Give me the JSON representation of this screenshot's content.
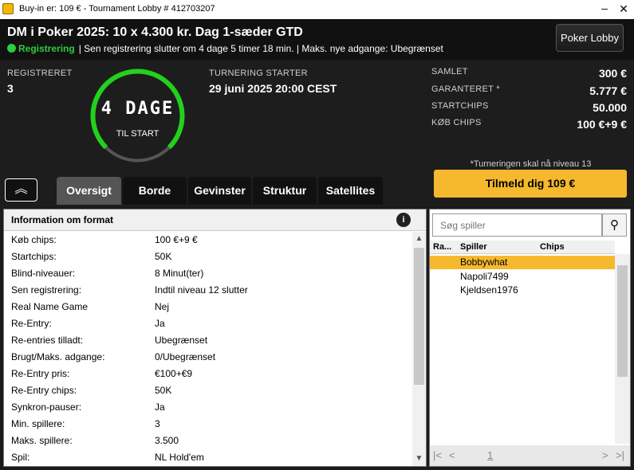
{
  "window": {
    "title": "Buy-in er: 109 € - Tournament Lobby # 412703207",
    "minimize": "–",
    "close": "✕"
  },
  "header": {
    "title": "DM i Poker 2025: 10 x 4.300 kr. Dag 1-sæder GTD",
    "status": "Registrering",
    "status_color": "#2ecc40",
    "info": "| Sen registrering slutter om 4 dage 5 timer   18 min.  | Maks. nye adgange: Ubegrænset",
    "lobby_button": "Poker Lobby"
  },
  "stats": {
    "registered_label": "REGISTRERET",
    "registered_value": "3",
    "countdown_value": "4 DAGE",
    "countdown_label": "TIL START",
    "start_label": "TURNERING STARTER",
    "start_value": "29 juni 2025  20:00 CEST"
  },
  "summary": {
    "rows": [
      {
        "label": "SAMLET",
        "value": "300 €"
      },
      {
        "label": "GARANTERET *",
        "value": "5.777 €"
      },
      {
        "label": "STARTCHIPS",
        "value": "50.000"
      },
      {
        "label": "KØB CHIPS",
        "value": "100 €+9 €"
      }
    ],
    "note": "*Turneringen skal nå niveau 13",
    "register_button": "Tilmeld dig  109 €"
  },
  "tabs": [
    "Oversigt",
    "Borde",
    "Gevinster",
    "Struktur",
    "Satellites"
  ],
  "collapse_icon": "double-chevron-up-icon",
  "info": {
    "heading": "Information om format",
    "info_icon": "i",
    "rows": [
      {
        "label": "Køb chips:",
        "value": "100 €+9 €"
      },
      {
        "label": "Startchips:",
        "value": "50K"
      },
      {
        "label": "Blind-niveauer:",
        "value": "8 Minut(ter)"
      },
      {
        "label": "Sen registrering:",
        "value": "Indtil niveau 12 slutter"
      },
      {
        "label": "Real Name Game",
        "value": "Nej"
      },
      {
        "label": "Re-Entry:",
        "value": "Ja"
      },
      {
        "label": "Re-entries tilladt:",
        "value": "Ubegrænset"
      },
      {
        "label": "Brugt/Maks. adgange:",
        "value": "0/Ubegrænset"
      },
      {
        "label": "Re-Entry pris:",
        "value": "€100+€9"
      },
      {
        "label": "Re-Entry chips:",
        "value": "50K"
      },
      {
        "label": "Synkron-pauser:",
        "value": "Ja"
      },
      {
        "label": "Min. spillere:",
        "value": "3"
      },
      {
        "label": "Maks. spillere:",
        "value": "3.500"
      },
      {
        "label": "Spil:",
        "value": "NL Hold'em"
      }
    ]
  },
  "players": {
    "search_placeholder": "Søg spiller",
    "columns": [
      "Ra...",
      "Spiller",
      "Chips"
    ],
    "list": [
      {
        "name": "Bobbywhat",
        "selected": true
      },
      {
        "name": "Napoli7499",
        "selected": false
      },
      {
        "name": "Kjeldsen1976",
        "selected": false
      }
    ],
    "page": "1"
  }
}
